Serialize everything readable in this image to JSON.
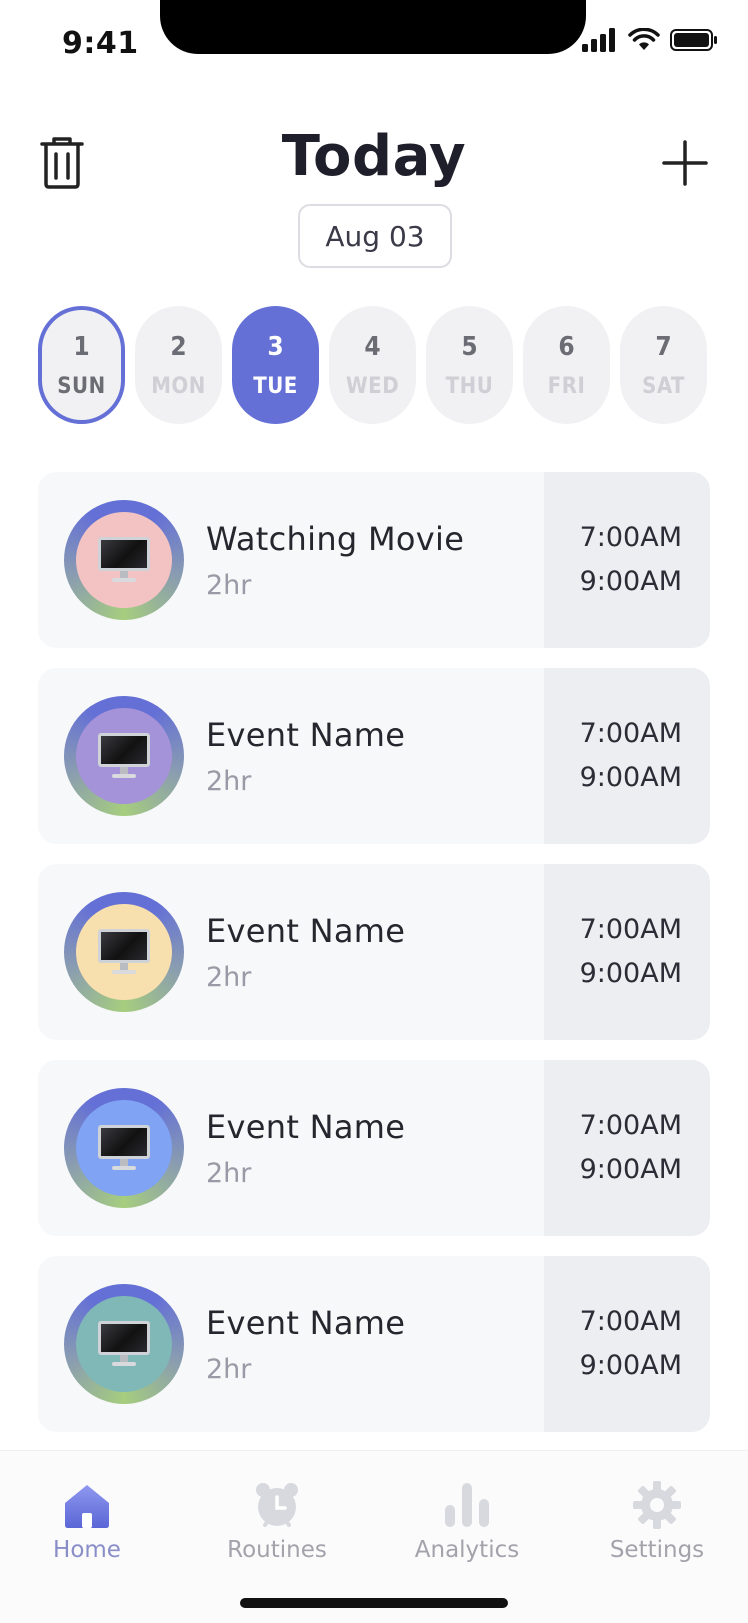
{
  "status_bar": {
    "time": "9:41"
  },
  "header": {
    "title": "Today",
    "date": "Aug 03"
  },
  "week": [
    {
      "num": "1",
      "dow": "SUN",
      "state": "today"
    },
    {
      "num": "2",
      "dow": "MON",
      "state": ""
    },
    {
      "num": "3",
      "dow": "TUE",
      "state": "selected"
    },
    {
      "num": "4",
      "dow": "WED",
      "state": ""
    },
    {
      "num": "5",
      "dow": "THU",
      "state": ""
    },
    {
      "num": "6",
      "dow": "FRI",
      "state": ""
    },
    {
      "num": "7",
      "dow": "SAT",
      "state": ""
    }
  ],
  "events": [
    {
      "name": "Watching Movie",
      "duration": "2hr",
      "start": "7:00AM",
      "end": "9:00AM",
      "icon": "monitor-icon",
      "color": "#f3c3c3"
    },
    {
      "name": "Event Name",
      "duration": "2hr",
      "start": "7:00AM",
      "end": "9:00AM",
      "icon": "monitor-icon",
      "color": "#a593d9"
    },
    {
      "name": "Event Name",
      "duration": "2hr",
      "start": "7:00AM",
      "end": "9:00AM",
      "icon": "monitor-icon",
      "color": "#f8dfae"
    },
    {
      "name": "Event Name",
      "duration": "2hr",
      "start": "7:00AM",
      "end": "9:00AM",
      "icon": "monitor-icon",
      "color": "#80a3f3"
    },
    {
      "name": "Event Name",
      "duration": "2hr",
      "start": "7:00AM",
      "end": "9:00AM",
      "icon": "monitor-icon",
      "color": "#80b8b8"
    }
  ],
  "tabs": [
    {
      "label": "Home",
      "icon": "home-icon",
      "active": true
    },
    {
      "label": "Routines",
      "icon": "alarm-clock-icon",
      "active": false
    },
    {
      "label": "Analytics",
      "icon": "bar-chart-icon",
      "active": false
    },
    {
      "label": "Settings",
      "icon": "gear-icon",
      "active": false
    }
  ],
  "colors": {
    "accent": "#6470d6"
  }
}
